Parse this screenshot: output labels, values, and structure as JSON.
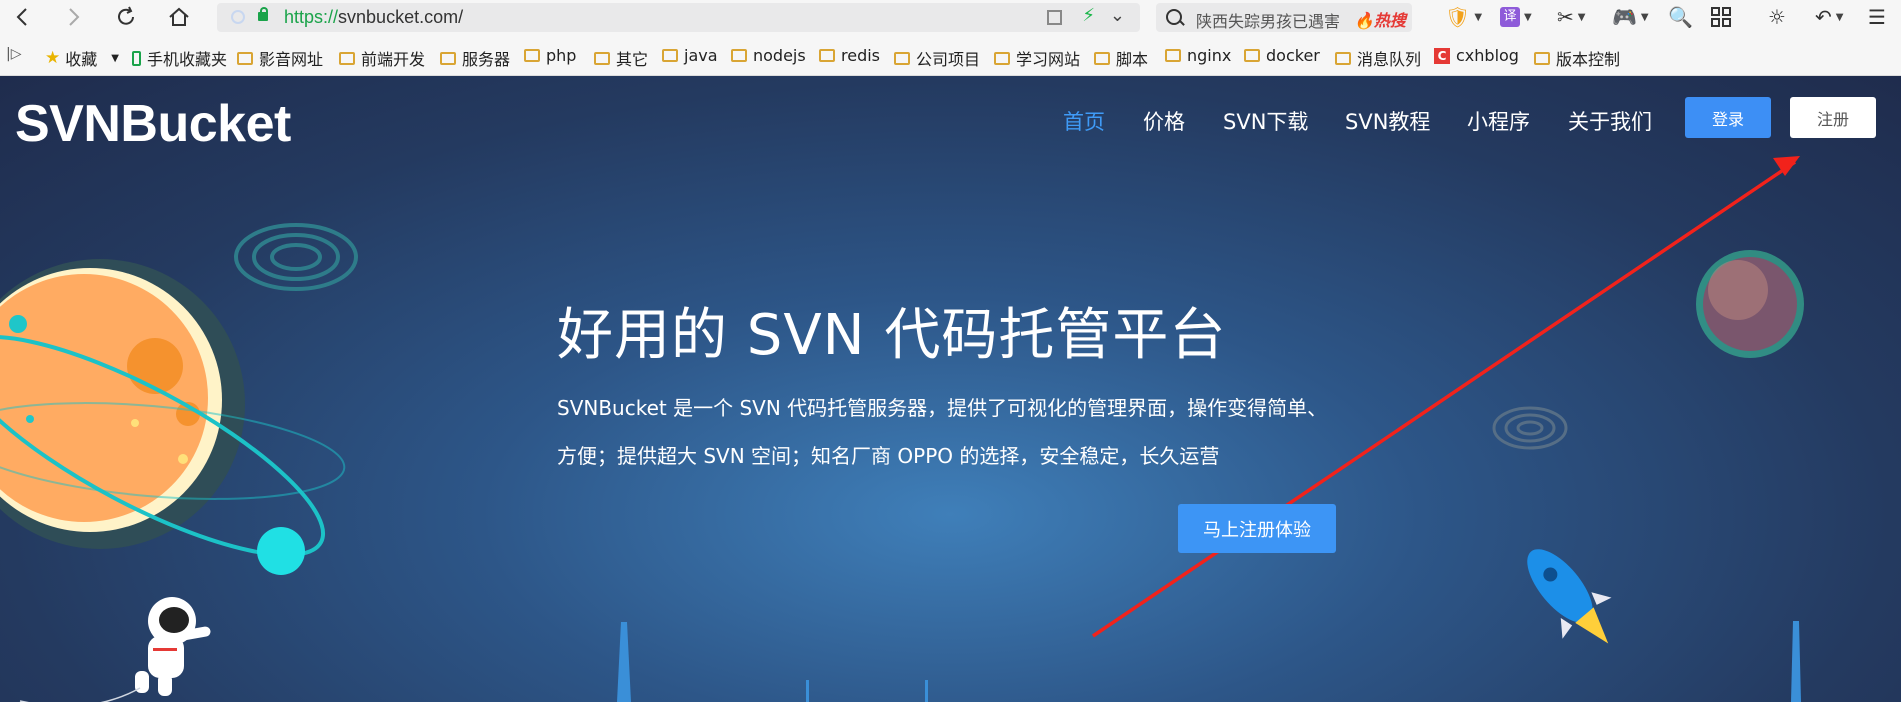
{
  "browser": {
    "url_protocol": "https://",
    "url_rest": "svnbucket.com/",
    "search_text": "陕西失踪男孩已遇害",
    "search_hot": "热搜",
    "bookmarks": [
      "收藏",
      "手机收藏夹",
      "影音网址",
      "前端开发",
      "服务器",
      "php",
      "其它",
      "java",
      "nodejs",
      "redis",
      "公司项目",
      "学习网站",
      "脚本",
      "nginx",
      "docker",
      "消息队列",
      "cxhblog",
      "版本控制"
    ]
  },
  "site": {
    "logo": "SVNBucket",
    "nav": [
      "首页",
      "价格",
      "SVN下载",
      "SVN教程",
      "小程序",
      "关于我们"
    ],
    "login_label": "登录",
    "register_label": "注册",
    "hero_title": "好用的 SVN 代码托管平台",
    "hero_desc_line1": "SVNBucket 是一个 SVN 代码托管服务器，提供了可视化的管理界面，操作变得简单、",
    "hero_desc_line2": "方便；提供超大 SVN 空间；知名厂商 OPPO 的选择，安全稳定，长久运营",
    "cta_label": "马上注册体验"
  },
  "colors": {
    "accent": "#3d8ff5",
    "nav_active": "#3f9bf7",
    "annotation_arrow": "#f2221b"
  }
}
